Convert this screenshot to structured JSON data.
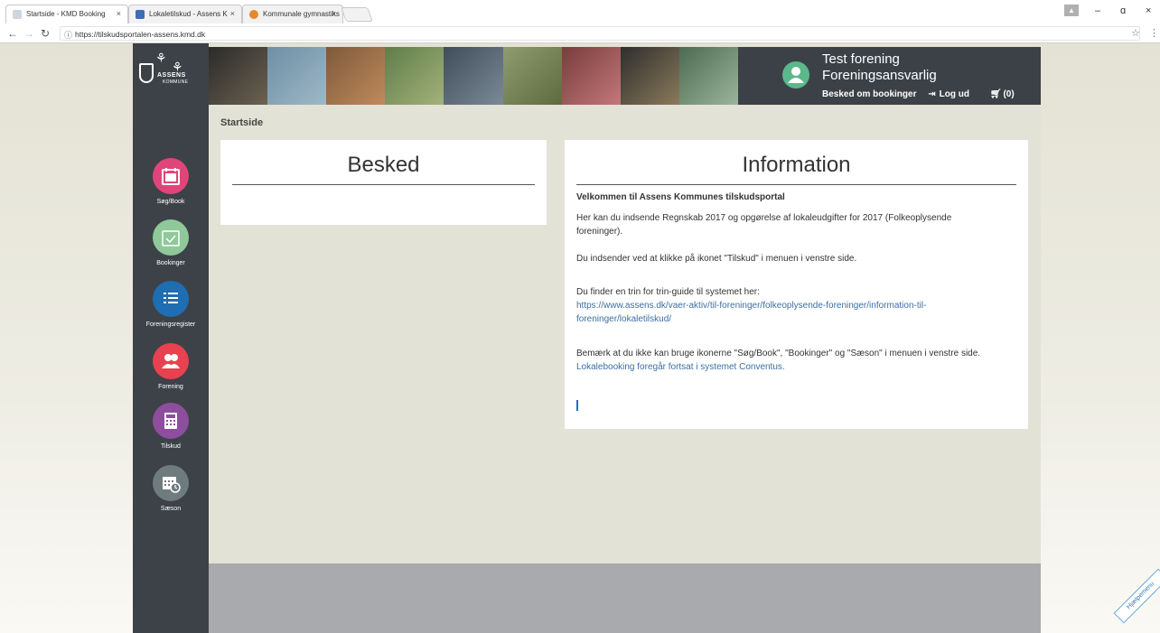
{
  "browser": {
    "tabs": [
      {
        "label": "Startside - KMD Booking",
        "close": "×"
      },
      {
        "label": "Lokaletilskud - Assens K",
        "close": "×"
      },
      {
        "label": "Kommunale gymnastiks",
        "close": "×"
      }
    ],
    "url": "https://tilskudsportalen-assens.kmd.dk",
    "window_controls": {
      "minimize": "–",
      "restore": "ɑ",
      "close": "×"
    }
  },
  "logo": {
    "name": "ASSENS",
    "sub": "KOMMUNE"
  },
  "sidebar": {
    "items": [
      {
        "label": "Søg/Book",
        "color": "#e0457a",
        "icon": "calendar-grid-icon"
      },
      {
        "label": "Bookinger",
        "color": "#8fc99a",
        "icon": "calendar-check-icon"
      },
      {
        "label": "Foreningsregister",
        "color": "#1f6db3",
        "icon": "list-icon"
      },
      {
        "label": "Forening",
        "color": "#e8414f",
        "icon": "users-icon"
      },
      {
        "label": "Tilskud",
        "color": "#8e4e9e",
        "icon": "calculator-icon"
      },
      {
        "label": "Sæson",
        "color": "#6f7c7e",
        "icon": "calendar-clock-icon"
      }
    ]
  },
  "header": {
    "org_name": "Test forening",
    "role": "Foreningsansvarlig",
    "links": {
      "notify": "Besked om bookinger",
      "logout": "Log ud",
      "cart": "(0)"
    }
  },
  "breadcrumb": "Startside",
  "besked": {
    "title": "Besked"
  },
  "information": {
    "title": "Information",
    "heading": "Velkommen til Assens Kommunes tilskudsportal",
    "p1": "Her kan du indsende Regnskab 2017 og opgørelse af lokaleudgifter for 2017 (Folkeoplysende",
    "p1b": "foreninger).",
    "p2": "Du indsender ved at klikke på ikonet \"Tilskud\" i menuen i venstre side.",
    "p3": "Du finder en trin for trin-guide til systemet her:",
    "link1": "https://www.assens.dk/vaer-aktiv/til-foreninger/folkeoplysende-foreninger/information-til-",
    "link1b": "foreninger/lokaletilskud/",
    "p4": "Bemærk at du ikke kan bruge ikonerne \"Søg/Book\", \"Bookinger\" og \"Sæson\" i menuen i venstre side.",
    "p4b": "Lokalebooking foregår fortsat i systemet Conventus."
  },
  "help_tab": "Hjælpemenu"
}
